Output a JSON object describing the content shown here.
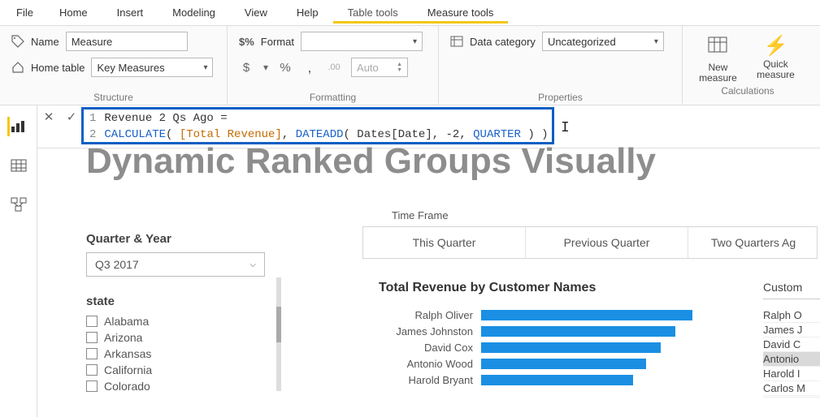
{
  "tabs": {
    "file": "File",
    "home": "Home",
    "insert": "Insert",
    "modeling": "Modeling",
    "view": "View",
    "help": "Help",
    "table_tools": "Table tools",
    "measure_tools": "Measure tools"
  },
  "ribbon": {
    "structure": {
      "name_label": "Name",
      "name_value": "Measure",
      "home_table_label": "Home table",
      "home_table_value": "Key Measures",
      "group_label": "Structure"
    },
    "formatting": {
      "format_label": "Format",
      "format_value": "",
      "currency": "$",
      "percent": "%",
      "comma": ",",
      "decimals_value": ".00",
      "auto": "Auto",
      "group_label": "Formatting"
    },
    "properties": {
      "data_category_label": "Data category",
      "data_category_value": "Uncategorized",
      "group_label": "Properties"
    },
    "calculations": {
      "new_measure": "New measure",
      "quick_measure": "Quick measure",
      "group_label": "Calculations"
    }
  },
  "formula": {
    "line1_num": "1",
    "line1_text": "Revenue 2 Qs Ago =",
    "line2_num": "2",
    "line2_calc": "CALCULATE",
    "line2_open": "( ",
    "line2_meas": "[Total Revenue]",
    "line2_mid1": ", ",
    "line2_dateadd": "DATEADD",
    "line2_mid2": "( Dates[Date], -2, ",
    "line2_quarter": "QUARTER",
    "line2_end": " ) )"
  },
  "canvas_title": "Dynamic Ranked Groups Visually",
  "slicer": {
    "heading": "Quarter & Year",
    "value": "Q3 2017",
    "state_heading": "state",
    "states": [
      "Alabama",
      "Arizona",
      "Arkansas",
      "California",
      "Colorado"
    ]
  },
  "timeframe": {
    "label": "Time Frame",
    "tabs": [
      "This Quarter",
      "Previous Quarter",
      "Two Quarters Ag"
    ]
  },
  "chart_data": {
    "type": "bar",
    "title": "Total Revenue by Customer Names",
    "categories": [
      "Ralph Oliver",
      "James Johnston",
      "David Cox",
      "Antonio Wood",
      "Harold Bryant"
    ],
    "values": [
      100,
      92,
      85,
      78,
      72
    ],
    "xlabel": "",
    "ylabel": "",
    "ylim": [
      0,
      100
    ]
  },
  "customer_list": {
    "heading": "Custom",
    "items": [
      "Ralph O",
      "James J",
      "David C",
      "Antonio",
      "Harold I",
      "Carlos M"
    ],
    "highlighted_index": 3
  }
}
